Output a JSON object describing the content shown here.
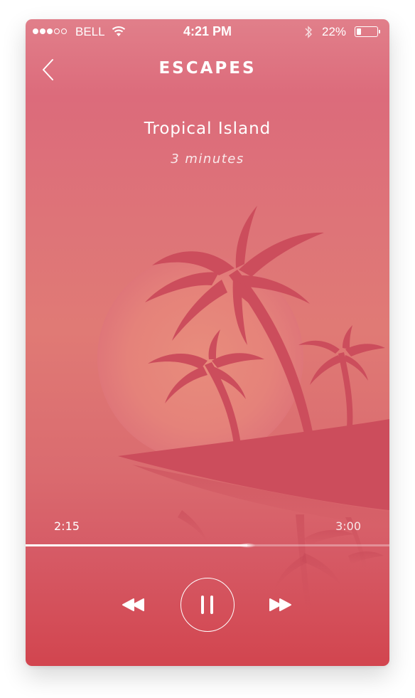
{
  "status_bar": {
    "carrier": "BELL",
    "time": "4:21 PM",
    "battery_percent": "22%",
    "signal_bars_filled": 3,
    "signal_bars_total": 5,
    "battery_level": 0.22,
    "icons": [
      "signal-dots-icon",
      "wifi-icon",
      "bluetooth-icon",
      "battery-icon"
    ]
  },
  "nav": {
    "title": "ESCAPES",
    "back_icon": "chevron-left-icon"
  },
  "track": {
    "title": "Tropical Island",
    "duration_label": "3 minutes",
    "artwork": "palm-trees-sunset-illustration"
  },
  "player": {
    "elapsed": "2:15",
    "total": "3:00",
    "progress": 0.61,
    "controls": {
      "rewind_icon": "rewind-icon",
      "pause_icon": "pause-icon",
      "fast_forward_icon": "fast-forward-icon"
    }
  },
  "colors": {
    "background_top": "#e17f8a",
    "background_bottom": "#d2454f",
    "sun": "#e6887a",
    "silhouette": "#cc4d5c",
    "foreground_text": "#ffffff"
  }
}
